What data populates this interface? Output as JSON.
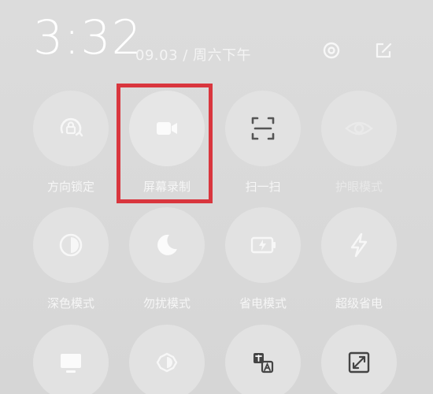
{
  "status": {
    "time": "3:32",
    "date": "09.03 / 周六下午"
  },
  "header_icons": [
    "gear-icon",
    "edit-icon"
  ],
  "tiles_row1": [
    {
      "label": "方向锁定",
      "icon": "rotation-lock-icon"
    },
    {
      "label": "屏幕录制",
      "icon": "video-camera-icon"
    },
    {
      "label": "扫一扫",
      "icon": "scan-icon"
    },
    {
      "label": "护眼模式",
      "icon": "eye-icon"
    }
  ],
  "tiles_row2": [
    {
      "label": "深色模式",
      "icon": "dark-mode-icon"
    },
    {
      "label": "勿扰模式",
      "icon": "moon-icon"
    },
    {
      "label": "省电模式",
      "icon": "battery-icon"
    },
    {
      "label": "超级省电",
      "icon": "lightning-icon"
    }
  ],
  "tiles_row3": [
    {
      "label": "",
      "icon": "screen-cast-icon"
    },
    {
      "label": "",
      "icon": "brightness-icon"
    },
    {
      "label": "",
      "icon": "translate-icon"
    },
    {
      "label": "",
      "icon": "expand-icon"
    }
  ],
  "highlight_color": "#d9363e"
}
